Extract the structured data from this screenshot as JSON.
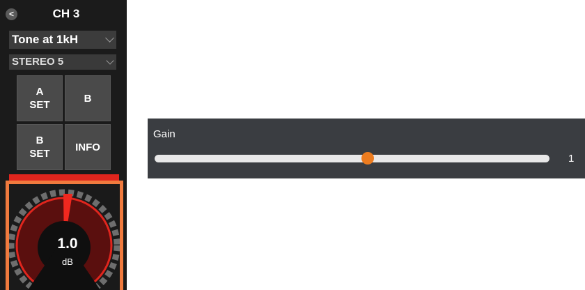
{
  "strip": {
    "back_label": "<",
    "title": "CH 3",
    "source_dropdown": {
      "value": "Tone at 1kH"
    },
    "output_dropdown": {
      "value": "STEREO 5"
    },
    "pads": [
      {
        "label": "A\nSET"
      },
      {
        "label": "B"
      },
      {
        "label": "B\nSET"
      },
      {
        "label": "INFO"
      }
    ],
    "knob": {
      "value": "1.0",
      "unit": "dB",
      "level_fraction": 0.5
    }
  },
  "gain": {
    "label": "Gain",
    "value": "1",
    "slider_fraction": 0.54
  },
  "colors": {
    "strip_bg": "#1b1b1b",
    "knob_frame": "#f07a3e",
    "knob_red": "#e0251d",
    "knob_dark_red": "#5a0f0e",
    "slider_thumb": "#ec7c1f",
    "panel_bg": "#3a3d41"
  }
}
